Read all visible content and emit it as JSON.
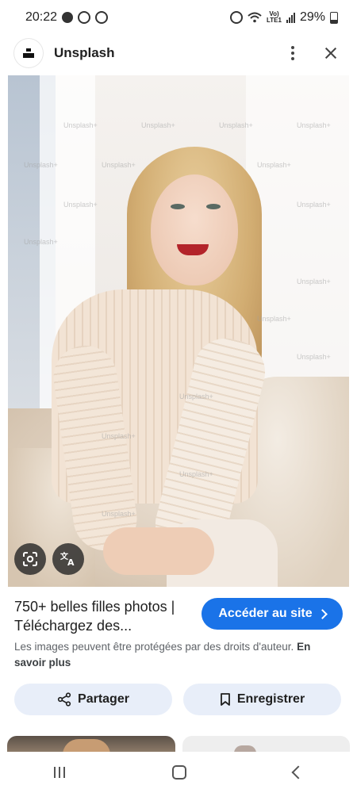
{
  "status_bar": {
    "time": "20:22",
    "lte_top": "Vo)",
    "lte_bottom": "LTE1",
    "battery": "29%"
  },
  "header": {
    "title": "Unsplash"
  },
  "photo": {
    "watermark": "Unsplash+"
  },
  "result": {
    "title": "750+ belles filles photos | Téléchargez des...",
    "visit_label": "Accéder au site",
    "disclaimer": "Les images peuvent être protégées par des droits d'auteur.",
    "learn_more": "En savoir plus"
  },
  "actions": {
    "share_label": "Partager",
    "save_label": "Enregistrer"
  },
  "colors": {
    "accent": "#1a73e8",
    "action_bg": "#e8eef9"
  }
}
